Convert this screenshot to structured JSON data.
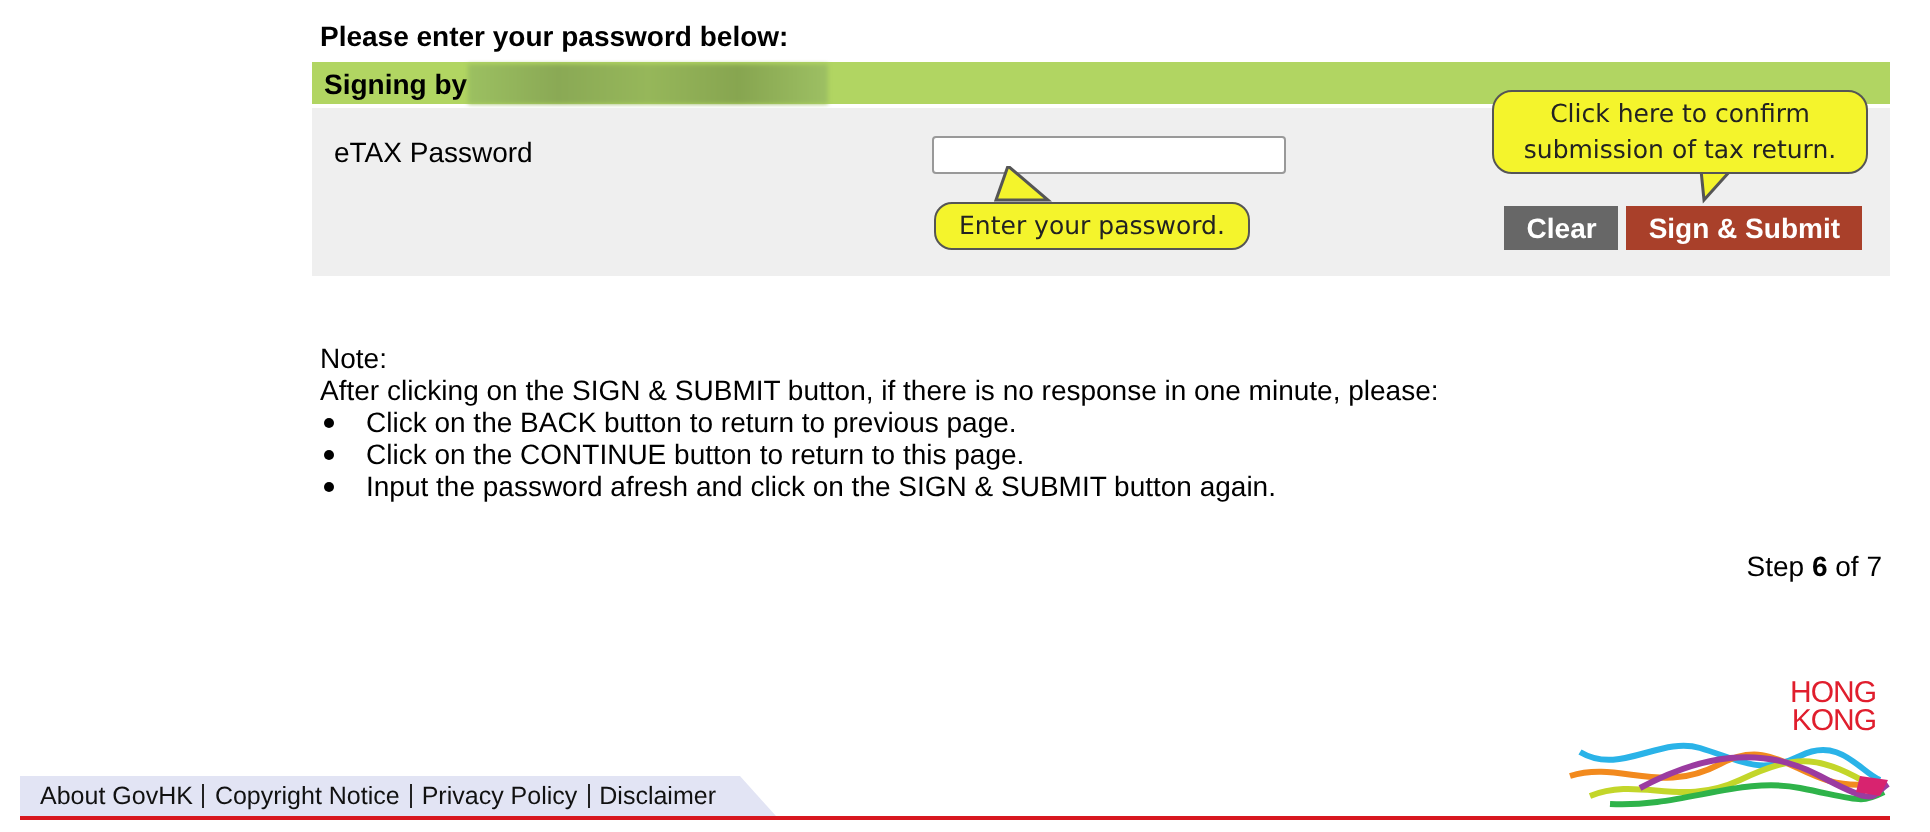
{
  "heading": "Please enter your password below:",
  "signing_bar": {
    "label": "Signing by"
  },
  "password": {
    "label": "eTAX Password",
    "hint": "Enter your password."
  },
  "buttons": [
    {
      "kind": "clear",
      "label": "Clear"
    },
    {
      "kind": "submit",
      "label": "Sign & Submit",
      "hint": "Click here to confirm submission of tax return."
    }
  ],
  "note": {
    "title": "Note:",
    "intro": "After clicking on the SIGN & SUBMIT button, if there is no response in one minute, please:",
    "items": [
      "Click on the BACK button to return to previous page.",
      "Click on the CONTINUE button to return to this page.",
      "Input the password afresh and click on the SIGN & SUBMIT button again."
    ]
  },
  "step": {
    "prefix": "Step",
    "current": "6",
    "suffix": "of 7"
  },
  "footer_links": [
    "About GovHK",
    "Copyright Notice",
    "Privacy Policy",
    "Disclaimer"
  ],
  "logo": {
    "lines": [
      "HONG",
      "KONG"
    ]
  }
}
